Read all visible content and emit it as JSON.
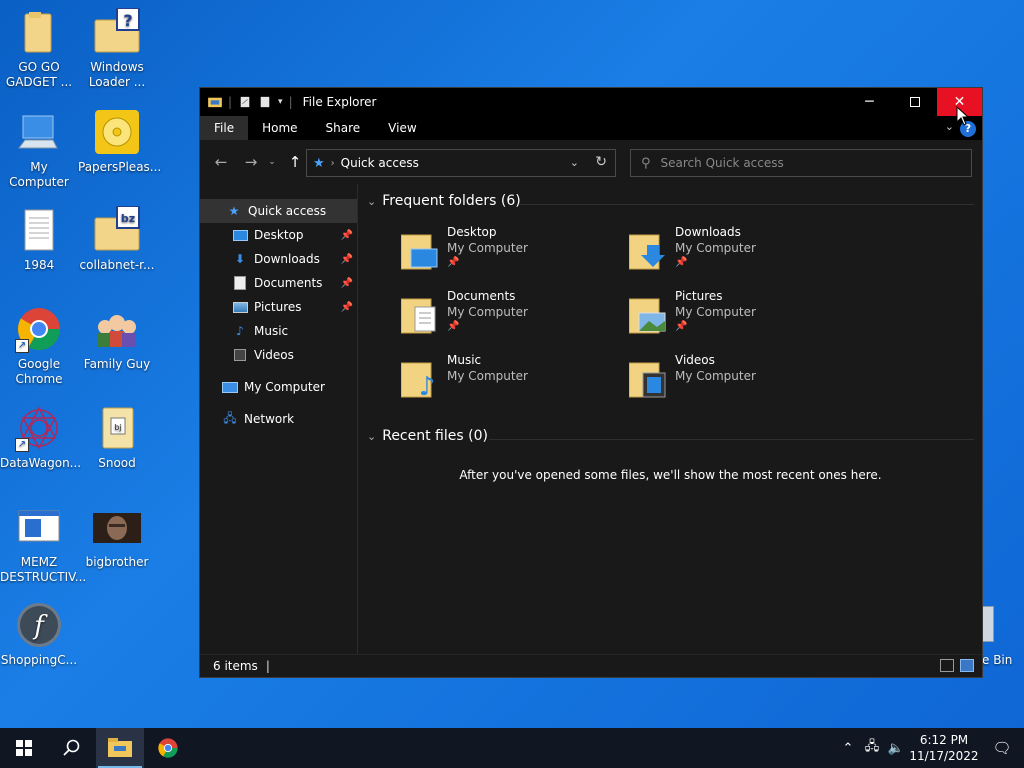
{
  "desktop": {
    "icons": [
      {
        "label": "GO GO\nGADGET ...",
        "icon": "folder-icon"
      },
      {
        "label": "Windows\nLoader ...",
        "icon": "help-folder-icon"
      },
      {
        "label": "My Computer",
        "icon": "computer-icon"
      },
      {
        "label": "PapersPleas...",
        "icon": "disc-icon"
      },
      {
        "label": "1984",
        "icon": "text-document-icon"
      },
      {
        "label": "collabnet-r...",
        "icon": "bz-folder-icon"
      },
      {
        "label": "Google\nChrome",
        "icon": "chrome-icon"
      },
      {
        "label": "Family Guy",
        "icon": "family-guy-icon"
      },
      {
        "label": "DataWagon...",
        "icon": "datawagon-icon"
      },
      {
        "label": "Snood",
        "icon": "snood-folder-icon"
      },
      {
        "label": "MEMZ\nDESTRUCTIV...",
        "icon": "memz-icon"
      },
      {
        "label": "bigbrother",
        "icon": "bigbrother-image-icon"
      },
      {
        "label": "ShoppingC...",
        "icon": "flash-icon"
      }
    ],
    "recycle_bin_label": "e Bin"
  },
  "window": {
    "title": "File Explorer",
    "ribbon_tabs": [
      "File",
      "Home",
      "Share",
      "View"
    ],
    "help_label": "?",
    "address": {
      "crumb": "Quick access"
    },
    "search_placeholder": "Search Quick access",
    "nav": [
      {
        "label": "Quick access",
        "icon": "star-icon",
        "pinned": false,
        "selected": true,
        "indent": 0
      },
      {
        "label": "Desktop",
        "icon": "desktop-icon",
        "pinned": true,
        "indent": 1
      },
      {
        "label": "Downloads",
        "icon": "download-icon",
        "pinned": true,
        "indent": 1
      },
      {
        "label": "Documents",
        "icon": "documents-icon",
        "pinned": true,
        "indent": 1
      },
      {
        "label": "Pictures",
        "icon": "pictures-icon",
        "pinned": true,
        "indent": 1
      },
      {
        "label": "Music",
        "icon": "music-icon",
        "pinned": false,
        "indent": 1
      },
      {
        "label": "Videos",
        "icon": "videos-icon",
        "pinned": false,
        "indent": 1
      },
      {
        "label": "My Computer",
        "icon": "computer-icon",
        "pinned": false,
        "indent": 0
      },
      {
        "label": "Network",
        "icon": "network-icon",
        "pinned": false,
        "indent": 0
      }
    ],
    "frequent": {
      "header": "Frequent folders (6)",
      "folders": [
        {
          "name": "Desktop",
          "location": "My Computer",
          "pinned": true,
          "icon": "desktop-folder-icon"
        },
        {
          "name": "Downloads",
          "location": "My Computer",
          "pinned": true,
          "icon": "downloads-folder-icon"
        },
        {
          "name": "Documents",
          "location": "My Computer",
          "pinned": true,
          "icon": "documents-folder-icon"
        },
        {
          "name": "Pictures",
          "location": "My Computer",
          "pinned": true,
          "icon": "pictures-folder-icon"
        },
        {
          "name": "Music",
          "location": "My Computer",
          "pinned": false,
          "icon": "music-folder-icon"
        },
        {
          "name": "Videos",
          "location": "My Computer",
          "pinned": false,
          "icon": "videos-folder-icon"
        }
      ]
    },
    "recent": {
      "header": "Recent files (0)",
      "empty_message": "After you've opened some files, we'll show the most recent ones here."
    },
    "status": {
      "items": "6 items"
    }
  },
  "taskbar": {
    "time": "6:12 PM",
    "date": "11/17/2022"
  }
}
